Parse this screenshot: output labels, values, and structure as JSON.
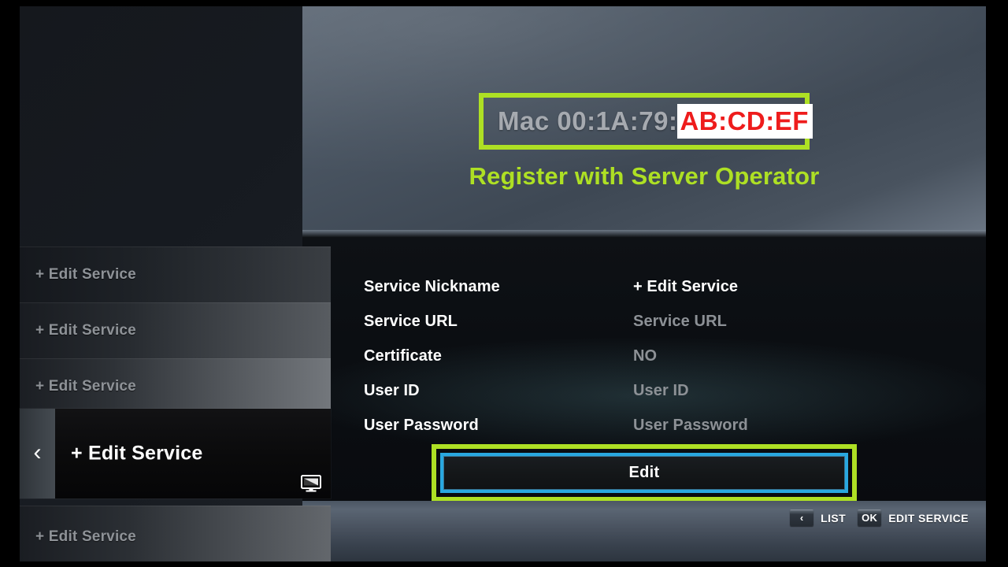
{
  "colors": {
    "annotation_green": "#aee024",
    "focus_blue": "#29a8e0",
    "alert_red": "#ee1c1c",
    "highlight_bg": "#ffffff"
  },
  "sidebar": {
    "items": [
      {
        "label": "+ Edit Service"
      },
      {
        "label": "+ Edit Service"
      },
      {
        "label": "+ Edit Service"
      },
      {
        "label": "+ Edit Service"
      }
    ],
    "selected": {
      "label": "+ Edit Service",
      "back_glyph": "‹",
      "device_icon": "monitor-icon"
    }
  },
  "hero": {
    "mac_prefix": "Mac 00:1A:79:",
    "mac_suffix": "AB:CD:EF",
    "register_note": "Register with Server Operator"
  },
  "form": {
    "rows": [
      {
        "label": "Service Nickname",
        "value": "+ Edit Service",
        "active": true
      },
      {
        "label": "Service URL",
        "value": "Service URL",
        "active": false
      },
      {
        "label": "Certificate",
        "value": "NO",
        "active": false
      },
      {
        "label": "User ID",
        "value": "User ID",
        "active": false
      },
      {
        "label": "User Password",
        "value": "User Password",
        "active": false
      }
    ],
    "edit_button_label": "Edit"
  },
  "footer": {
    "hints": [
      {
        "key": "‹",
        "label": "LIST"
      },
      {
        "key": "OK",
        "label": "EDIT SERVICE"
      }
    ]
  }
}
